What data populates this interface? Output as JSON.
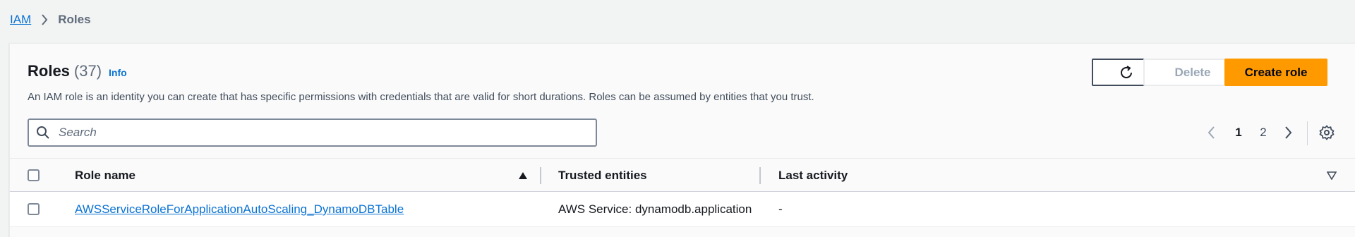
{
  "breadcrumb": {
    "root": "IAM",
    "current": "Roles"
  },
  "header": {
    "title": "Roles",
    "count": "(37)",
    "info": "Info",
    "description": "An IAM role is an identity you can create that has specific permissions with credentials that are valid for short durations. Roles can be assumed by entities that you trust."
  },
  "actions": {
    "delete_label": "Delete",
    "create_label": "Create role"
  },
  "search": {
    "placeholder": "Search",
    "value": ""
  },
  "pagination": {
    "page1": "1",
    "page2": "2",
    "current_page": 1
  },
  "table": {
    "columns": [
      "Role name",
      "Trusted entities",
      "Last activity"
    ],
    "sort": {
      "column": "Role name",
      "direction": "ascending"
    },
    "rows": [
      {
        "role_name": "AWSServiceRoleForApplicationAutoScaling_DynamoDBTable",
        "trusted_entities": "AWS Service: dynamodb.application",
        "last_activity": "-"
      }
    ]
  },
  "colors": {
    "link": "#0972d3",
    "primary": "#ff9900",
    "text": "#16191f",
    "muted": "#5f6b7a"
  },
  "icons": [
    "chevron-right-icon",
    "refresh-icon",
    "search-icon",
    "chevron-left-icon",
    "settings-gear-icon",
    "sort-up-icon",
    "sort-down-icon"
  ]
}
